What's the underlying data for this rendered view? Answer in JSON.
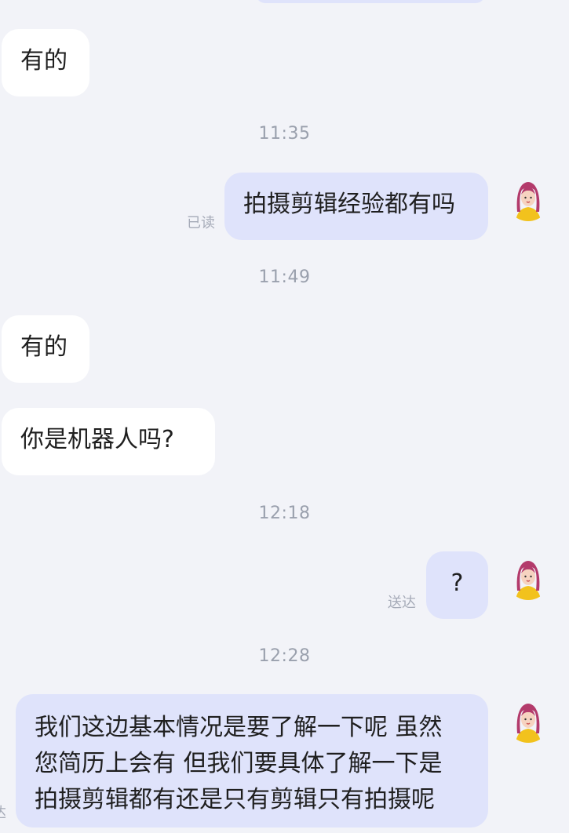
{
  "messages": [
    {
      "side": "left",
      "text": "有的"
    },
    {
      "time": "11:35"
    },
    {
      "side": "right",
      "text": "拍摄剪辑经验都有吗",
      "status": "已读"
    },
    {
      "time": "11:49"
    },
    {
      "side": "left",
      "text": "有的"
    },
    {
      "side": "left",
      "text": "你是机器人吗?"
    },
    {
      "time": "12:18"
    },
    {
      "side": "right",
      "text": "?",
      "status": "送达"
    },
    {
      "time": "12:28"
    },
    {
      "side": "right",
      "lines": [
        "我们这边基本情况是要了解一下呢 虽然",
        "您简历上会有 但我们要具体了解一下是",
        "拍摄剪辑都有还是只有剪辑只有拍摄呢"
      ],
      "status": "达"
    }
  ],
  "timestamps": {
    "t1": "11:35",
    "t2": "11:49",
    "t3": "12:18",
    "t4": "12:28"
  },
  "labels": {
    "read": "已读",
    "delivered": "送达",
    "partial": "达"
  },
  "text": {
    "m1": "有的",
    "m2": "拍摄剪辑经验都有吗",
    "m3": "有的",
    "m4": "你是机器人吗?",
    "m5": "?",
    "m6_l1": "我们这边基本情况是要了解一下呢 虽然",
    "m6_l2": "您简历上会有 但我们要具体了解一下是",
    "m6_l3": "拍摄剪辑都有还是只有剪辑只有拍摄呢"
  },
  "colors": {
    "background": "#f2f3f8",
    "incoming_bubble": "#ffffff",
    "outgoing_bubble": "#dfe3fb",
    "timestamp": "#9aa0ad",
    "status": "#a6abb8"
  },
  "avatar_icon": "woman-avatar-icon"
}
